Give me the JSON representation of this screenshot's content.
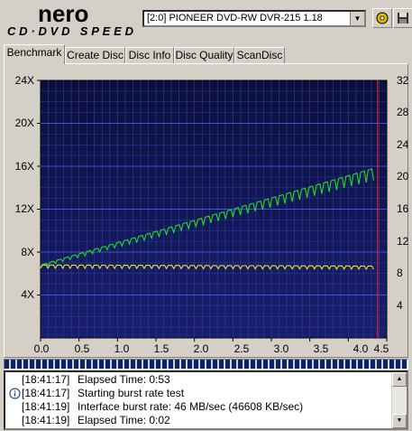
{
  "app": {
    "logo_top": "nero",
    "logo_bottom": "CD·DVD SPEED"
  },
  "drive": {
    "selected": "[2:0]  PIONEER DVD-RW  DVR-215 1.18"
  },
  "toolbar": {
    "buttons": [
      {
        "name": "start-icon"
      },
      {
        "name": "save-icon"
      }
    ]
  },
  "tabs": [
    {
      "label": "Benchmark",
      "active": true
    },
    {
      "label": "Create Disc",
      "active": false
    },
    {
      "label": "Disc Info",
      "active": false
    },
    {
      "label": "Disc Quality",
      "active": false
    },
    {
      "label": "ScanDisc",
      "active": false
    }
  ],
  "chart_data": {
    "type": "line",
    "title": "",
    "xlabel": "",
    "ylabel": "",
    "xlim": [
      0.0,
      4.5
    ],
    "ylim_left": [
      0,
      24
    ],
    "ylim_right": [
      0,
      32
    ],
    "x_ticks": [
      "0.0",
      "0.5",
      "1.0",
      "1.5",
      "2.0",
      "2.5",
      "3.0",
      "3.5",
      "4.0",
      "4.5"
    ],
    "y_ticks_left": [
      "24X",
      "20X",
      "16X",
      "12X",
      "8X",
      "4X"
    ],
    "y_ticks_right": [
      "32",
      "28",
      "24",
      "20",
      "16",
      "12",
      "8",
      "4"
    ],
    "grid": true,
    "background": "#1a1f6e",
    "series": [
      {
        "color": "#22dd22",
        "axis": "left",
        "start": [
          0.0,
          6.8
        ],
        "end": [
          4.33,
          15.8
        ],
        "jagged": true
      },
      {
        "color": "#e6e62a",
        "axis": "left",
        "start": [
          0.0,
          6.8
        ],
        "end": [
          4.33,
          6.7
        ],
        "jagged": true
      }
    ],
    "marker_line": {
      "x": 4.38,
      "color": "#e02020"
    }
  },
  "progress": {
    "value": 1.0
  },
  "log": [
    {
      "time": "[18:41:17]",
      "message": "Elapsed Time:  0:53",
      "icon": ""
    },
    {
      "time": "[18:41:17]",
      "message": "Starting burst rate test",
      "icon": "info-icon"
    },
    {
      "time": "[18:41:19]",
      "message": "Interface burst rate: 46 MB/sec (46608 KB/sec)",
      "icon": ""
    },
    {
      "time": "[18:41:19]",
      "message": "Elapsed Time:  0:02",
      "icon": ""
    }
  ]
}
